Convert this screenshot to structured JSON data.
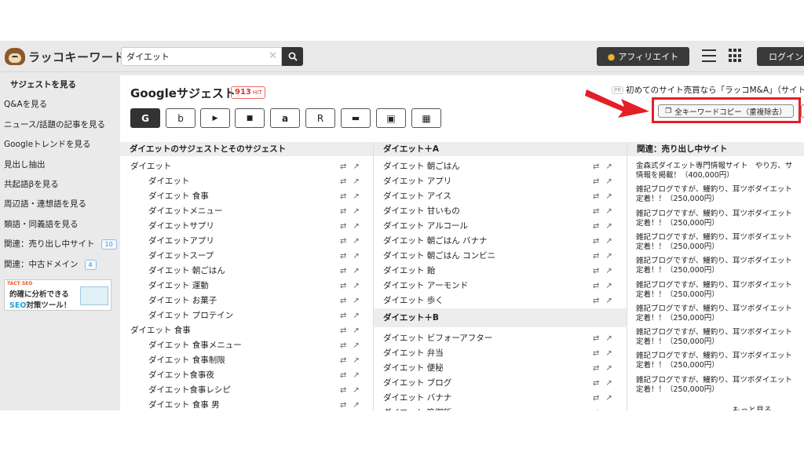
{
  "header": {
    "logo_text": "ラッコキーワード",
    "search_value": "ダイエット",
    "affiliate_label": "アフィリエイト",
    "login_label": "ログイン"
  },
  "sidebar": {
    "items": [
      {
        "label": "サジェストを見る",
        "active": true
      },
      {
        "label": "Q&Aを見る"
      },
      {
        "label": "ニュース/話題の記事を見る"
      },
      {
        "label": "Googleトレンドを見る"
      },
      {
        "label": "見出し抽出"
      },
      {
        "label": "共起語βを見る"
      },
      {
        "label": "周辺語・連想語を見る"
      },
      {
        "label": "類語・同義語を見る"
      },
      {
        "label": "関連：売り出し中サイト",
        "count": "10"
      },
      {
        "label": "関連：中古ドメイン",
        "count": "4"
      }
    ],
    "banner": {
      "brand": "TACT SEO",
      "line1": "的確に分析できる",
      "line2a": "SEO",
      "line2b": "対策ツール！"
    }
  },
  "main": {
    "title": "Googleサジェスト",
    "hit_count": "913",
    "hit_unit": "HIT",
    "pr_tag": "PR",
    "pr_text": "初めてのサイト売買なら「ラッコM&A」（サイト",
    "engines": [
      {
        "name": "google",
        "glyph": "G",
        "active": true
      },
      {
        "name": "bing",
        "glyph": "b"
      },
      {
        "name": "youtube",
        "glyph": "▶"
      },
      {
        "name": "video",
        "glyph": "■"
      },
      {
        "name": "amazon",
        "glyph": "a"
      },
      {
        "name": "rakuten",
        "glyph": "R"
      },
      {
        "name": "shopping",
        "glyph": "🛒"
      },
      {
        "name": "image",
        "glyph": "▣"
      },
      {
        "name": "more",
        "glyph": "▦"
      }
    ],
    "copy_label": "全キーワードコピー（重複除去）"
  },
  "columns": {
    "col1": {
      "header": "ダイエットのサジェストとそのサジェスト",
      "rows": [
        {
          "text": "ダイエット",
          "indent": false
        },
        {
          "text": "ダイエット",
          "indent": true
        },
        {
          "text": "ダイエット 食事",
          "indent": true
        },
        {
          "text": "ダイエットメニュー",
          "indent": true
        },
        {
          "text": "ダイエットサプリ",
          "indent": true
        },
        {
          "text": "ダイエットアプリ",
          "indent": true
        },
        {
          "text": "ダイエットスープ",
          "indent": true
        },
        {
          "text": "ダイエット 朝ごはん",
          "indent": true
        },
        {
          "text": "ダイエット 運動",
          "indent": true
        },
        {
          "text": "ダイエット お菓子",
          "indent": true
        },
        {
          "text": "ダイエット プロテイン",
          "indent": true
        },
        {
          "text": "ダイエット 食事",
          "indent": false
        },
        {
          "text": "ダイエット 食事メニュー",
          "indent": true
        },
        {
          "text": "ダイエット 食事制限",
          "indent": true
        },
        {
          "text": "ダイエット食事夜",
          "indent": true
        },
        {
          "text": "ダイエット食事レシピ",
          "indent": true
        },
        {
          "text": "ダイエット 食事 男",
          "indent": true
        }
      ]
    },
    "col2": {
      "header": "ダイエット＋A",
      "rows_a": [
        "ダイエット 朝ごはん",
        "ダイエット アプリ",
        "ダイエット アイス",
        "ダイエット 甘いもの",
        "ダイエット アルコール",
        "ダイエット 朝ごはん バナナ",
        "ダイエット 朝ごはん コンビニ",
        "ダイエット 飴",
        "ダイエット アーモンド",
        "ダイエット 歩く"
      ],
      "sub_header": "ダイエット＋B",
      "rows_b": [
        "ダイエット ビフォーアフター",
        "ダイエット 弁当",
        "ダイエット 便秘",
        "ダイエット ブログ",
        "ダイエット バナナ",
        "ダイエット 晩御飯"
      ]
    },
    "col3": {
      "header": "関連：売り出し中サイト",
      "items": [
        {
          "line1": "金森式ダイエット専門情報サイト　やり方、サ",
          "line2": "情報を掲載！（400,000円）"
        },
        {
          "line1": "雑記ブログですが、鰻釣り、耳ツボダイエット",
          "line2": "定着！！（250,000円）"
        },
        {
          "line1": "雑記ブログですが、鰻釣り、耳ツボダイエット",
          "line2": "定着！！（250,000円）"
        },
        {
          "line1": "雑記ブログですが、鰻釣り、耳ツボダイエット",
          "line2": "定着！！（250,000円）"
        },
        {
          "line1": "雑記ブログですが、鰻釣り、耳ツボダイエット",
          "line2": "定着！！（250,000円）"
        },
        {
          "line1": "雑記ブログですが、鰻釣り、耳ツボダイエット",
          "line2": "定着！！（250,000円）"
        },
        {
          "line1": "雑記ブログですが、鰻釣り、耳ツボダイエット",
          "line2": "定着！！（250,000円）"
        },
        {
          "line1": "雑記ブログですが、鰻釣り、耳ツボダイエット",
          "line2": "定着！！（250,000円）"
        },
        {
          "line1": "雑記ブログですが、鰻釣り、耳ツボダイエット",
          "line2": "定着！！（250,000円）"
        },
        {
          "line1": "雑記ブログですが、鰻釣り、耳ツボダイエット",
          "line2": "定着！！（250,000円）"
        }
      ],
      "more_label": "もっと見る"
    }
  },
  "colors": {
    "accent_red": "#e41e26",
    "dark": "#333333",
    "badge_blue": "#3b8fd0"
  },
  "icons": {
    "row_actions": [
      "retweet-icon",
      "external-link-icon"
    ],
    "search": "search-icon",
    "copy": "copy-icon"
  }
}
